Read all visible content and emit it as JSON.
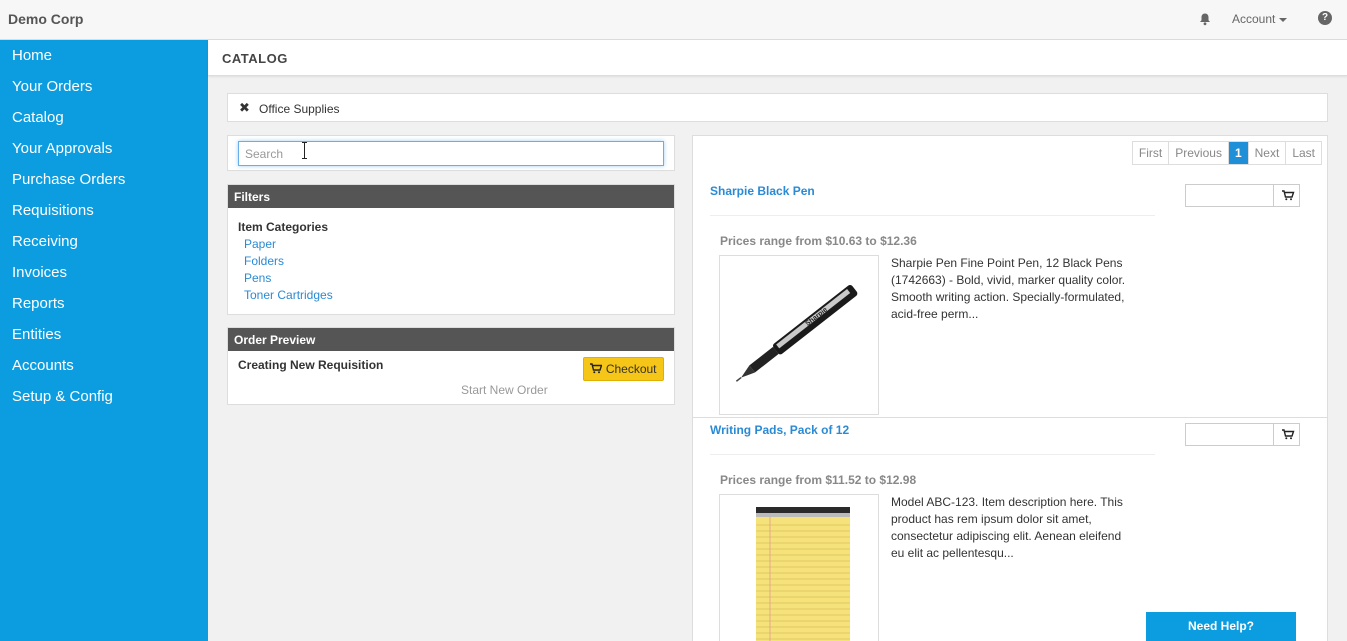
{
  "app": {
    "brand": "Demo Corp"
  },
  "topbar": {
    "account_label": "Account",
    "help_glyph": "?"
  },
  "sidebar": {
    "items": [
      {
        "label": "Home"
      },
      {
        "label": "Your Orders"
      },
      {
        "label": "Catalog"
      },
      {
        "label": "Your Approvals"
      },
      {
        "label": "Purchase Orders"
      },
      {
        "label": "Requisitions"
      },
      {
        "label": "Receiving"
      },
      {
        "label": "Invoices"
      },
      {
        "label": "Reports"
      },
      {
        "label": "Entities"
      },
      {
        "label": "Accounts"
      },
      {
        "label": "Setup & Config"
      }
    ]
  },
  "page": {
    "title": "CATALOG"
  },
  "breadcrumb": {
    "remove_glyph": "✖",
    "label": "Office Supplies"
  },
  "search": {
    "placeholder": "Search",
    "value": ""
  },
  "filters": {
    "title": "Filters",
    "category_heading": "Item Categories",
    "categories": [
      "Paper",
      "Folders",
      "Pens",
      "Toner Cartridges"
    ]
  },
  "order_preview": {
    "title": "Order Preview",
    "status": "Creating New Requisition",
    "checkout_label": "Checkout",
    "start_new_label": "Start New Order"
  },
  "pagination": {
    "first": "First",
    "previous": "Previous",
    "current": "1",
    "next": "Next",
    "last": "Last"
  },
  "products": [
    {
      "title": "Sharpie Black Pen",
      "price_range": "Prices range from $10.63 to $12.36",
      "description": "Sharpie Pen Fine Point Pen, 12 Black Pens (1742663) - Bold, vivid, marker quality color. Smooth writing action. Specially-formulated, acid-free perm...",
      "image_label": "Sharpie"
    },
    {
      "title": "Writing Pads, Pack of 12",
      "price_range": "Prices range from $11.52 to $12.98",
      "description": "Model ABC-123. Item description here. This product has rem ipsum dolor sit amet, consectetur adipiscing elit. Aenean eleifend eu elit ac pellentesqu..."
    }
  ],
  "support": {
    "need_help_label": "Need Help?"
  },
  "colors": {
    "sidebar": "#0b9de0",
    "link": "#2a8ad4",
    "checkout": "#f5c518",
    "pager_active": "#1f8fd8"
  }
}
